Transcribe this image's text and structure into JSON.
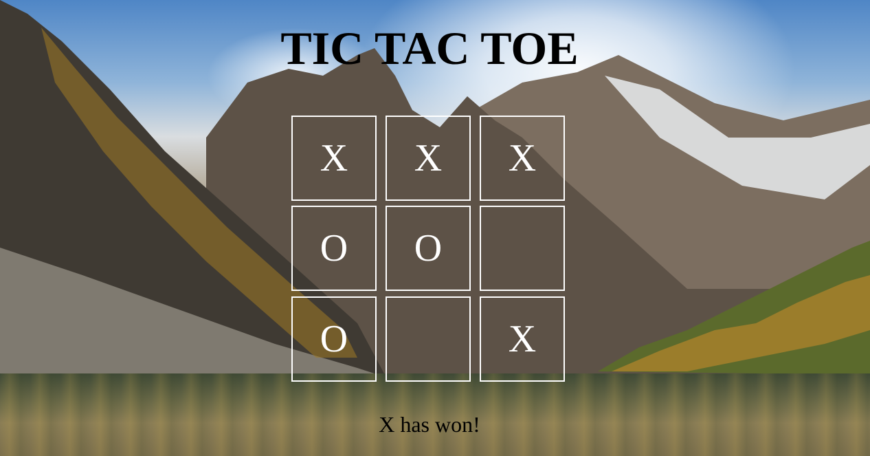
{
  "title": "TIC TAC TOE",
  "board": {
    "cells": [
      "X",
      "X",
      "X",
      "O",
      "O",
      "",
      "O",
      "",
      "X"
    ]
  },
  "status": "X has won!",
  "colors": {
    "cell_border": "#ffffff",
    "mark": "#ffffff",
    "title": "#000000",
    "status": "#000000"
  }
}
